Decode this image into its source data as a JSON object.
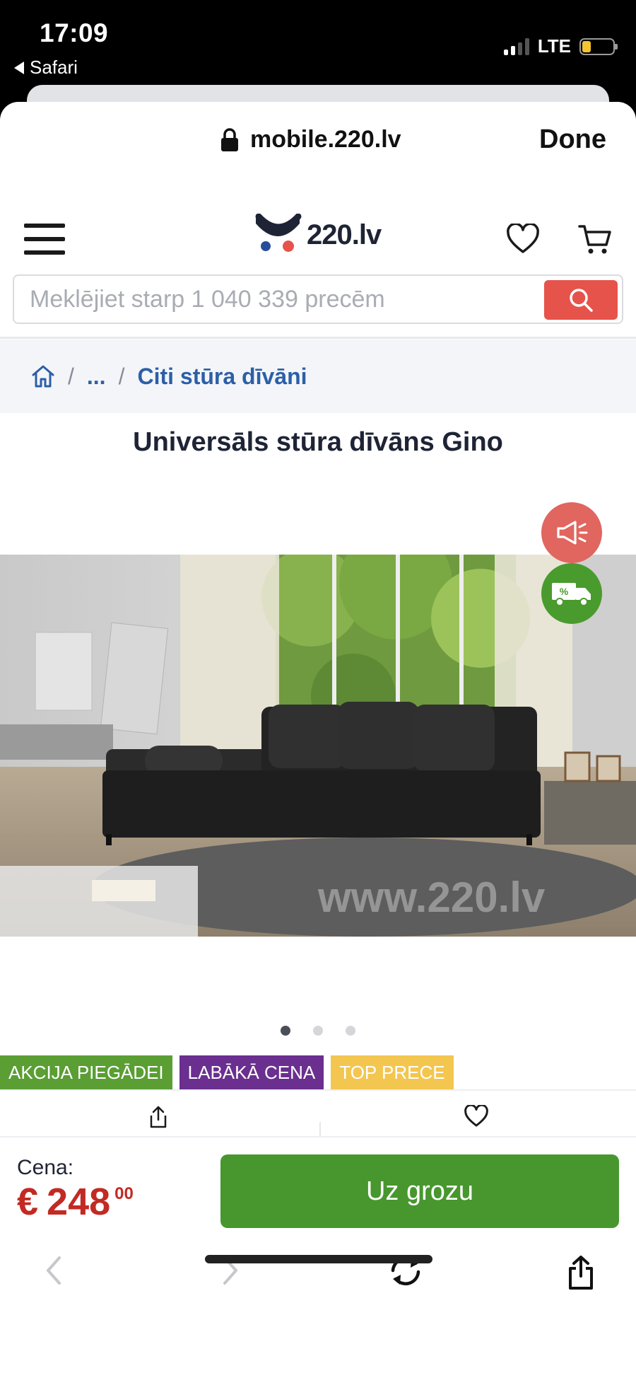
{
  "status_bar": {
    "time": "17:09",
    "back_app": "Safari",
    "network": "LTE",
    "battery_level": 0.25
  },
  "safari_view": {
    "url": "mobile.220.lv",
    "done_label": "Done"
  },
  "site": {
    "logo_text": "220.lv",
    "search_placeholder": "Meklējiet starp 1 040 339 precēm",
    "search_value": ""
  },
  "breadcrumb": {
    "separator": "/",
    "ellipsis": "...",
    "current": "Citi stūra dīvāni"
  },
  "product": {
    "title": "Universāls stūra dīvāns Gino",
    "image_watermark": "www.220.lv",
    "image_count": 3,
    "active_image": 1,
    "badges": [
      {
        "label": "AKCIJA PIEGĀDEI",
        "color": "#5a9e34"
      },
      {
        "label": "LABĀKĀ CENA",
        "color": "#6a2f8f"
      },
      {
        "label": "TOP PRECE",
        "color": "#f3c650"
      }
    ],
    "delivery_badge": "%"
  },
  "purchase": {
    "price_label": "Cena:",
    "currency": "€",
    "price_main": "248",
    "price_cents": "00",
    "cart_button": "Uz grozu"
  },
  "colors": {
    "accent_red": "#e6534a",
    "price_red": "#c22a24",
    "cart_green": "#47972e",
    "link_blue": "#2c5fa8"
  },
  "icons": [
    "lock-icon",
    "hamburger-menu-icon",
    "heart-icon",
    "cart-icon",
    "search-icon",
    "home-icon",
    "megaphone-icon",
    "delivery-truck-icon",
    "share-icon",
    "back-arrow-icon",
    "forward-arrow-icon",
    "reload-icon"
  ]
}
